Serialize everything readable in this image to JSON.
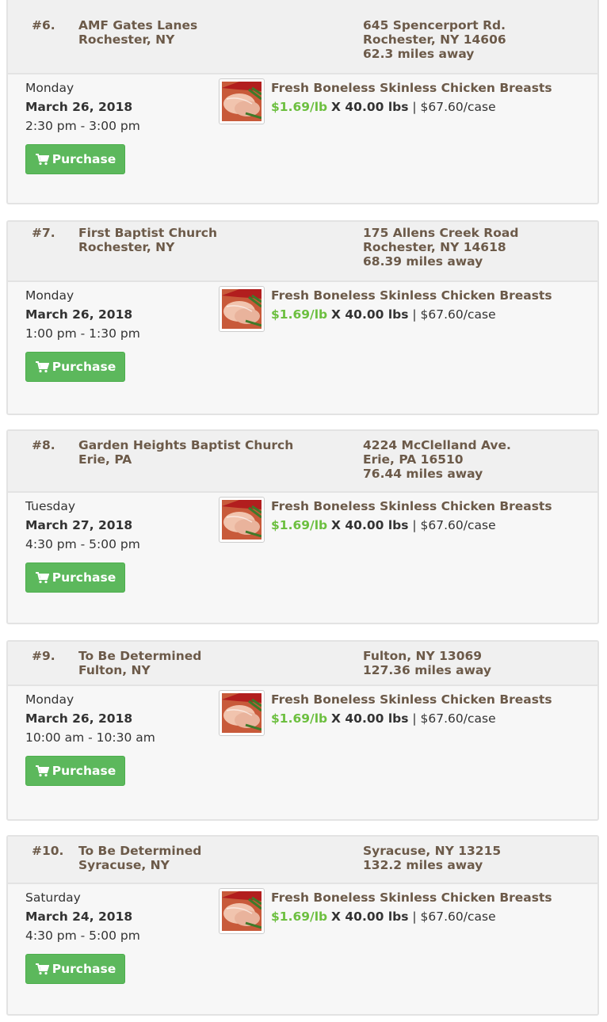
{
  "colors": {
    "accent_green": "#5cb85c",
    "price_green": "#6cbf3f",
    "brown_text": "#6c5a49"
  },
  "icons": {
    "cart": "shopping-cart-icon",
    "product": "chicken-breast-thumbnail"
  },
  "listings": [
    {
      "number": "#6.",
      "location_name": "AMF Gates Lanes",
      "location_city": "Rochester, NY",
      "address_lines": [
        "645 Spencerport Rd.",
        "Rochester, NY 14606",
        "62.3 miles away"
      ],
      "day": "Monday",
      "date": "March 26, 2018",
      "time": "2:30 pm - 3:00 pm",
      "product_name": "Fresh Boneless Skinless Chicken Breasts",
      "price": "$1.69/lb",
      "quantity": "X 40.00 lbs",
      "case_price": "| $67.60/case",
      "button_label": "Purchase"
    },
    {
      "number": "#7.",
      "location_name": "First Baptist Church",
      "location_city": "Rochester, NY",
      "address_lines": [
        "175 Allens Creek Road",
        "Rochester, NY 14618",
        "68.39 miles away"
      ],
      "day": "Monday",
      "date": "March 26, 2018",
      "time": "1:00 pm - 1:30 pm",
      "product_name": "Fresh Boneless Skinless Chicken Breasts",
      "price": "$1.69/lb",
      "quantity": "X 40.00 lbs",
      "case_price": "| $67.60/case",
      "button_label": "Purchase"
    },
    {
      "number": "#8.",
      "location_name": "Garden Heights Baptist Church",
      "location_city": "Erie, PA",
      "address_lines": [
        "4224 McClelland Ave.",
        "Erie, PA 16510",
        "76.44 miles away"
      ],
      "day": "Tuesday",
      "date": "March 27, 2018",
      "time": "4:30 pm - 5:00 pm",
      "product_name": "Fresh Boneless Skinless Chicken Breasts",
      "price": "$1.69/lb",
      "quantity": "X 40.00 lbs",
      "case_price": "| $67.60/case",
      "button_label": "Purchase"
    },
    {
      "number": "#9.",
      "location_name": "To Be Determined",
      "location_city": "Fulton, NY",
      "address_lines": [
        "Fulton, NY 13069",
        "127.36 miles away"
      ],
      "day": "Monday",
      "date": "March 26, 2018",
      "time": "10:00 am - 10:30 am",
      "product_name": "Fresh Boneless Skinless Chicken Breasts",
      "price": "$1.69/lb",
      "quantity": "X 40.00 lbs",
      "case_price": "| $67.60/case",
      "button_label": "Purchase"
    },
    {
      "number": "#10.",
      "location_name": "To Be Determined",
      "location_city": "Syracuse, NY",
      "address_lines": [
        "Syracuse, NY 13215",
        "132.2 miles away"
      ],
      "day": "Saturday",
      "date": "March 24, 2018",
      "time": "4:30 pm - 5:00 pm",
      "product_name": "Fresh Boneless Skinless Chicken Breasts",
      "price": "$1.69/lb",
      "quantity": "X 40.00 lbs",
      "case_price": "| $67.60/case",
      "button_label": "Purchase"
    }
  ]
}
